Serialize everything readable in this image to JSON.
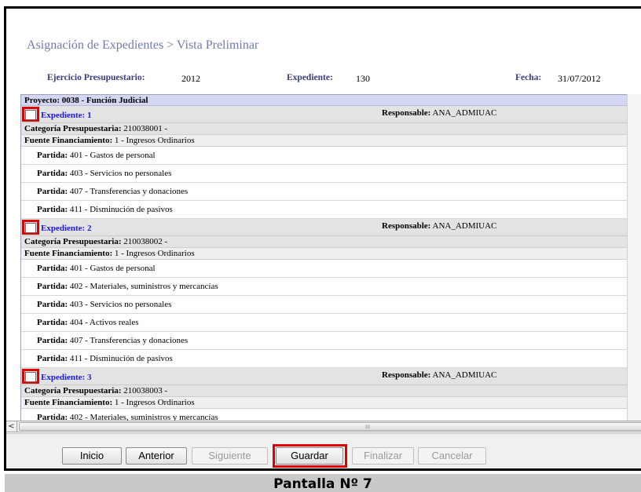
{
  "title": "Asignación de Expedientes > Vista Preliminar",
  "info": {
    "ejercicio_label": "Ejercicio Presupuestario:",
    "ejercicio_value": "2012",
    "expediente_label": "Expediente:",
    "expediente_value": "130",
    "fecha_label": "Fecha:",
    "fecha_value": "31/07/2012"
  },
  "proyecto": "Proyecto: 0038 - Función Judicial",
  "expedientes": [
    {
      "label": "Expediente: 1",
      "responsable_label": "Responsable:",
      "responsable_value": "ANA_ADMIUAC",
      "categoria_label": "Categoría Presupuestaria:",
      "categoria_value": "210038001 -",
      "fuente_label": "Fuente Financiamiento:",
      "fuente_value": "1 - Ingresos Ordinarios",
      "partidas": [
        {
          "label": "Partida:",
          "value": "401 - Gastos de personal"
        },
        {
          "label": "Partida:",
          "value": "403 - Servicios no personales"
        },
        {
          "label": "Partida:",
          "value": "407 - Transferencias y donaciones"
        },
        {
          "label": "Partida:",
          "value": "411 - Disminución de pasivos"
        }
      ]
    },
    {
      "label": "Expediente: 2",
      "responsable_label": "Responsable:",
      "responsable_value": "ANA_ADMIUAC",
      "categoria_label": "Categoría Presupuestaria:",
      "categoria_value": "210038002 -",
      "fuente_label": "Fuente Financiamiento:",
      "fuente_value": "1 - Ingresos Ordinarios",
      "partidas": [
        {
          "label": "Partida:",
          "value": "401 - Gastos de personal"
        },
        {
          "label": "Partida:",
          "value": "402 - Materiales, suministros y mercancías"
        },
        {
          "label": "Partida:",
          "value": "403 - Servicios no personales"
        },
        {
          "label": "Partida:",
          "value": "404 - Activos reales"
        },
        {
          "label": "Partida:",
          "value": "407 - Transferencias y donaciones"
        },
        {
          "label": "Partida:",
          "value": "411 - Disminución de pasivos"
        }
      ]
    },
    {
      "label": "Expediente: 3",
      "responsable_label": "Responsable:",
      "responsable_value": "ANA_ADMIUAC",
      "categoria_label": "Categoría Presupuestaria:",
      "categoria_value": "210038003 -",
      "fuente_label": "Fuente Financiamiento:",
      "fuente_value": "1 - Ingresos Ordinarios",
      "partidas": [
        {
          "label": "Partida:",
          "value": "402 - Materiales, suministros y mercancías"
        }
      ]
    }
  ],
  "buttons": {
    "inicio": "Inicio",
    "anterior": "Anterior",
    "siguiente": "Siguiente",
    "guardar": "Guardar",
    "finalizar": "Finalizar",
    "cancelar": "Cancelar"
  },
  "scrollbar": {
    "left_arrow": "<",
    "grip": "III"
  },
  "caption": "Pantalla Nº 7",
  "colors": {
    "highlight": "#e00000",
    "link": "#1b1bd8",
    "project_row": "#d4d7f3",
    "title": "#6f7ca8"
  }
}
